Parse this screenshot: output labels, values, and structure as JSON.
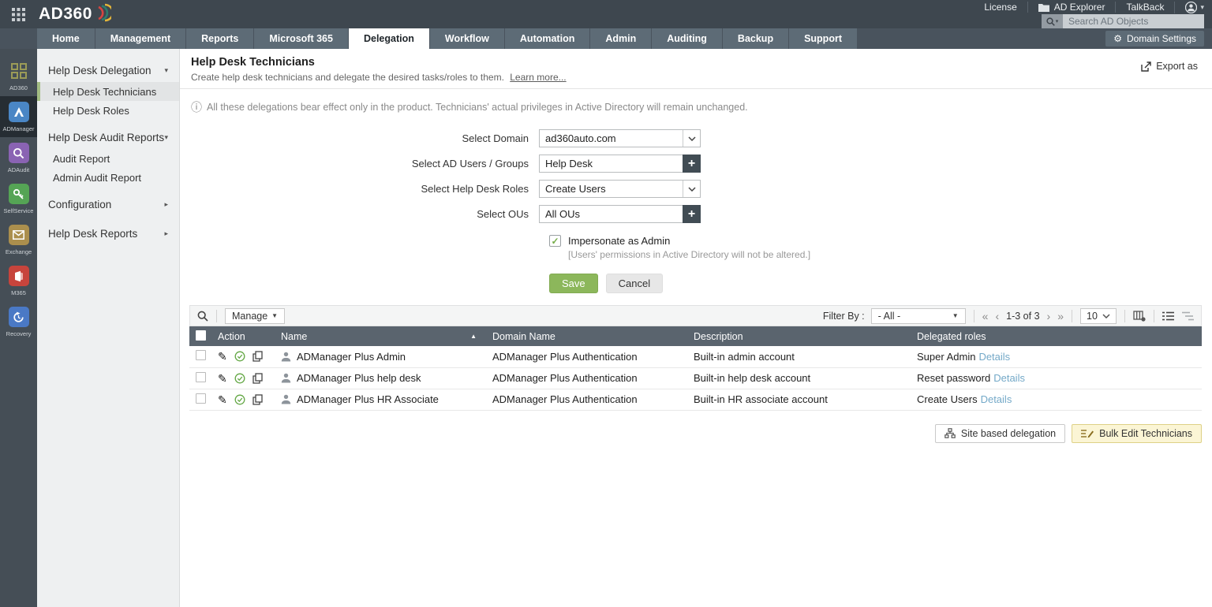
{
  "topbar": {
    "logo": "AD360",
    "links": {
      "license": "License",
      "ad_explorer": "AD Explorer",
      "talkback": "TalkBack"
    },
    "search_placeholder": "Search AD Objects"
  },
  "nav": {
    "tabs": [
      {
        "label": "Home",
        "active": false
      },
      {
        "label": "Management",
        "active": false
      },
      {
        "label": "Reports",
        "active": false
      },
      {
        "label": "Microsoft 365",
        "active": false
      },
      {
        "label": "Delegation",
        "active": true
      },
      {
        "label": "Workflow",
        "active": false
      },
      {
        "label": "Automation",
        "active": false
      },
      {
        "label": "Admin",
        "active": false
      },
      {
        "label": "Auditing",
        "active": false
      },
      {
        "label": "Backup",
        "active": false
      },
      {
        "label": "Support",
        "active": false
      }
    ],
    "domain_settings_label": "Domain Settings"
  },
  "sidebar": {
    "items": [
      {
        "label": "AD360",
        "active": false
      },
      {
        "label": "ADManager",
        "active": true
      },
      {
        "label": "ADAudit",
        "active": false
      },
      {
        "label": "SelfService",
        "active": false
      },
      {
        "label": "Exchange",
        "active": false
      },
      {
        "label": "M365",
        "active": false
      },
      {
        "label": "Recovery",
        "active": false
      }
    ]
  },
  "menu": {
    "items": [
      {
        "type": "header",
        "label": "Help Desk Delegation",
        "state": "expanded"
      },
      {
        "type": "sub",
        "label": "Help Desk Technicians",
        "selected": true
      },
      {
        "type": "sub",
        "label": "Help Desk Roles",
        "selected": false
      },
      {
        "type": "header",
        "label": "Help Desk Audit Reports",
        "state": "expanded"
      },
      {
        "type": "sub",
        "label": "Audit Report",
        "selected": false
      },
      {
        "type": "sub",
        "label": "Admin Audit Report",
        "selected": false
      },
      {
        "type": "header",
        "label": "Configuration",
        "state": "collapsed"
      },
      {
        "type": "header",
        "label": "Help Desk Reports",
        "state": "collapsed"
      }
    ]
  },
  "page": {
    "title": "Help Desk Technicians",
    "subtitle": "Create help desk technicians and delegate the desired tasks/roles to them.",
    "learn_more": "Learn more...",
    "export_as": "Export as",
    "info_note": "All these delegations bear effect only in the product. Technicians' actual privileges in Active Directory will remain unchanged."
  },
  "form": {
    "fields": [
      {
        "label": "Select Domain",
        "value": "ad360auto.com",
        "control": "select"
      },
      {
        "label": "Select AD Users / Groups",
        "value": "Help Desk",
        "control": "picker"
      },
      {
        "label": "Select Help Desk Roles",
        "value": "Create Users",
        "control": "select"
      },
      {
        "label": "Select OUs",
        "value": "All OUs",
        "control": "picker"
      }
    ],
    "impersonate": {
      "label": "Impersonate as Admin",
      "checked": true,
      "note": "[Users' permissions in Active Directory will not be altered.]"
    },
    "save_label": "Save",
    "cancel_label": "Cancel"
  },
  "toolbar": {
    "manage_label": "Manage",
    "filter_by_label": "Filter By :",
    "filter_value": "- All -",
    "pagination": {
      "range": "1-3 of 3",
      "page_size": "10"
    }
  },
  "table": {
    "columns": {
      "action": "Action",
      "name": "Name",
      "domain": "Domain Name",
      "description": "Description",
      "roles": "Delegated roles"
    },
    "sorted_column": "Name",
    "rows": [
      {
        "name": "ADManager Plus Admin",
        "domain": "ADManager Plus Authentication",
        "description": "Built-in admin account",
        "role": "Super Admin",
        "details_label": "Details"
      },
      {
        "name": "ADManager Plus help desk",
        "domain": "ADManager Plus Authentication",
        "description": "Built-in help desk account",
        "role": "Reset password",
        "details_label": "Details"
      },
      {
        "name": "ADManager Plus HR Associate",
        "domain": "ADManager Plus Authentication",
        "description": "Built-in HR associate account",
        "role": "Create Users",
        "details_label": "Details"
      }
    ]
  },
  "actions": {
    "site_button": "Site based delegation",
    "bulk_button": "Bulk Edit Technicians"
  },
  "icons": {
    "caret_down": "▾",
    "caret_right": "▸",
    "caret_select": "▼",
    "sort_asc": "▲",
    "plus": "+",
    "check": "✓",
    "info": "ⓘ",
    "gear": "⚙",
    "pencil": "✎",
    "page_first": "«",
    "page_prev": "‹",
    "page_next": "›",
    "page_last": "»"
  },
  "colors": {
    "topbar": "#3e474f",
    "navbar": "#49535d",
    "tab_bg": "#5d6b76",
    "table_header": "#5a646e",
    "accent_green": "#8cb75b",
    "selected_menu_border": "#a3bd83",
    "link_blue": "#74a9c8",
    "warn_button_bg": "#fbf5d5"
  }
}
